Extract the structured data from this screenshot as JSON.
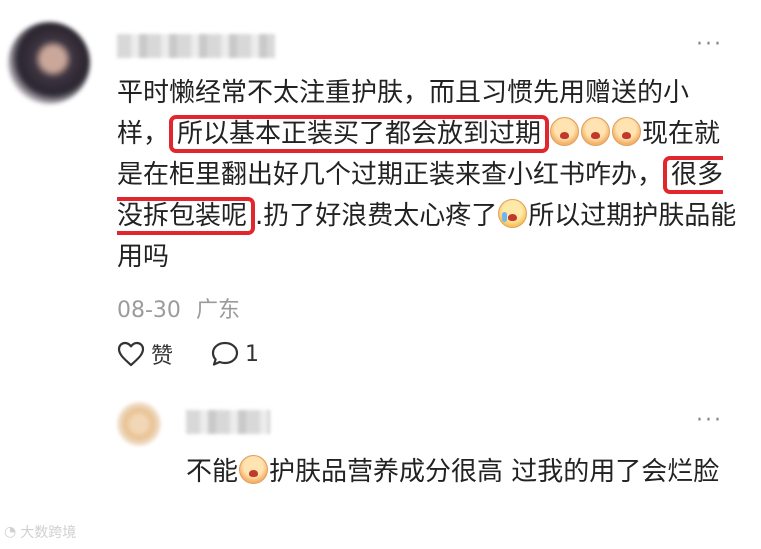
{
  "comment": {
    "line_pre": "平时懒经常不太注重护肤，而且习惯先用赠送的小样，",
    "highlight1": "所以基本正装买了都会放到过期",
    "mid": "现在就是在柜里翻出好几个过期正装来查小红书咋办，",
    "highlight2": "很多没拆包装呢",
    "post": ".扔了好浪费太心疼了",
    "end": "所以过期护肤品能用吗",
    "date": "08-30",
    "location": "广东",
    "like_label": "赞",
    "reply_count": "1"
  },
  "reply": {
    "text_pre": "不能",
    "text_post": "护肤品营养成分很高 过我的用了会烂脸"
  },
  "more_icon": "···",
  "watermark": "大数跨境",
  "colors": {
    "highlight": "#e2262e",
    "meta": "#9b9b9b"
  }
}
